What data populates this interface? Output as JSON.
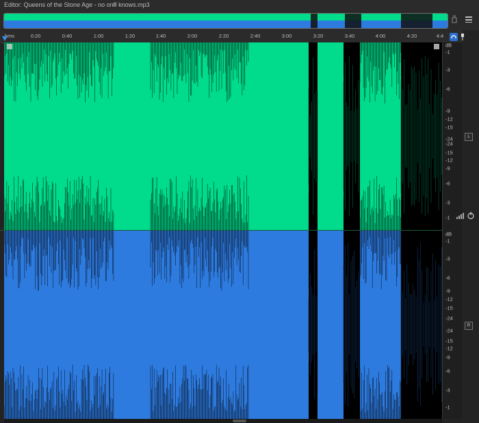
{
  "editor_title": "Editor: Queens of the Stone Age - no one knows.mp3",
  "editor_menu_glyph": "≡",
  "colors": {
    "left_channel": "#00dc8c",
    "right_channel": "#2e7be0",
    "background": "#232323",
    "playhead": "#3a8ee6"
  },
  "ruler": {
    "unit_label": "hms",
    "ticks": [
      "0:20",
      "0:40",
      "1:00",
      "1:20",
      "1:40",
      "2:00",
      "2:20",
      "2:40",
      "3:00",
      "3:20",
      "3:40",
      "4:00",
      "4:20",
      "4:4"
    ]
  },
  "channels": {
    "left_label": "L",
    "right_label": "R"
  },
  "db_scale": {
    "unit": "dB",
    "top_labels": [
      "-1",
      "-3",
      "-6",
      "-9",
      "-12",
      "-15",
      "-24"
    ],
    "bottom_labels": [
      "-24",
      "-15",
      "-12",
      "-9",
      "-6",
      "-3",
      "-1"
    ]
  },
  "icons": {
    "overview_tool": "selection-hand-icon",
    "panel_menu": "panel-menu-icon",
    "zoom_lock": "headphones-icon",
    "marker": "pin-icon",
    "volume": "volume-icon",
    "power": "power-icon"
  }
}
